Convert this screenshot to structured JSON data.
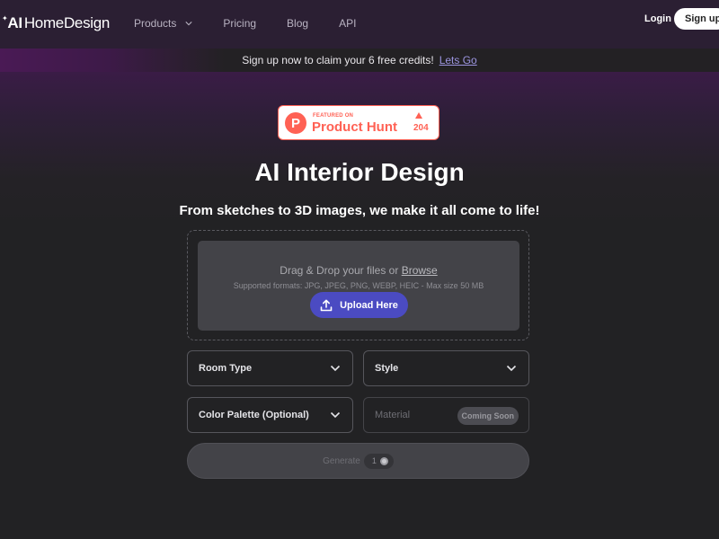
{
  "navbar": {
    "logo": {
      "sparkle": "✦",
      "ai": "AI",
      "rest": "HomeDesign"
    },
    "links": [
      {
        "label": "Products",
        "has_dropdown": true
      },
      {
        "label": "Pricing"
      },
      {
        "label": "Blog"
      },
      {
        "label": "API"
      }
    ],
    "login_label": "Login",
    "signup_label": "Sign up"
  },
  "banner": {
    "text": "Sign up now to claim your 6 free credits!",
    "link_label": "Lets Go"
  },
  "product_hunt": {
    "logo_letter": "P",
    "featured_label": "FEATURED ON",
    "name": "Product Hunt",
    "upvotes": "204",
    "color": "#ff6154"
  },
  "hero": {
    "title": "AI Interior Design",
    "subtitle": "From sketches to 3D images, we make it all come to life!"
  },
  "upload": {
    "drag_text": "Drag & Drop your files or",
    "browse_label": "Browse",
    "formats_text": "Supported formats: JPG, JPEG, PNG, WEBP, HEIC - Max size 50 MB",
    "button_label": "Upload Here",
    "accent_color": "#4b4bc2"
  },
  "form": {
    "room_type": {
      "label": "Room Type"
    },
    "style": {
      "label": "Style"
    },
    "color_palette": {
      "label": "Color Palette (Optional)"
    },
    "material": {
      "label": "Material",
      "badge": "Coming Soon",
      "disabled": true
    }
  },
  "generate": {
    "label": "Generate",
    "credit_cost": "1",
    "disabled": true
  }
}
